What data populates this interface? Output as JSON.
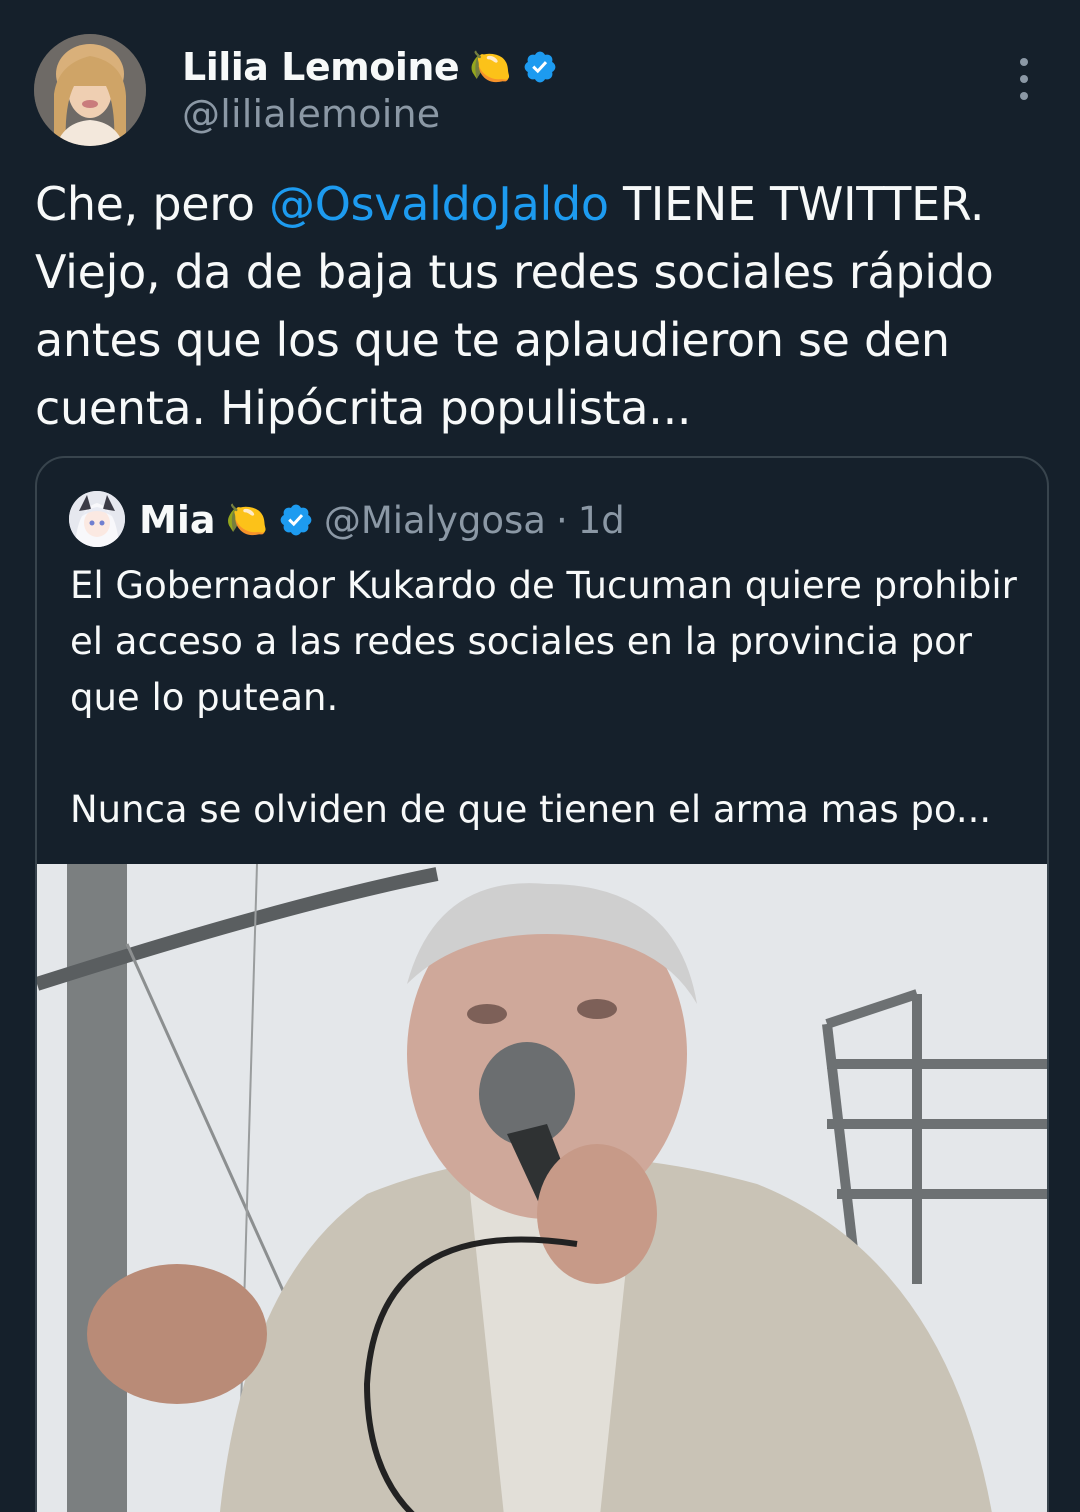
{
  "tweet": {
    "author": {
      "name": "Lilia Lemoine",
      "emoji": "🍋",
      "handle": "@lilialemoine",
      "verified": true
    },
    "text_before": "Che, pero ",
    "mention": "@OsvaldoJaldo",
    "text_after": " TIENE TWITTER. Viejo, da de baja tus redes sociales rápido antes que los que te aplaudieron se den cuenta. Hipócrita populista..."
  },
  "quote": {
    "author": {
      "name": "Mia",
      "emoji": "🍋",
      "handle": "@Mialygosa",
      "separator": "·",
      "time": "1d",
      "verified": true
    },
    "text": "El Gobernador Kukardo de Tucuman quiere prohibir el acceso a las redes sociales en la provincia por que lo putean.\n\nNunca se olviden de que tienen el arma mas po..."
  },
  "colors": {
    "background": "#15202b",
    "text": "#f7f9f9",
    "secondary": "#8b98a5",
    "link": "#1d9bf0",
    "border": "#38444d"
  },
  "icons": [
    "verified-badge-icon",
    "more-options-icon",
    "lemon-emoji"
  ]
}
